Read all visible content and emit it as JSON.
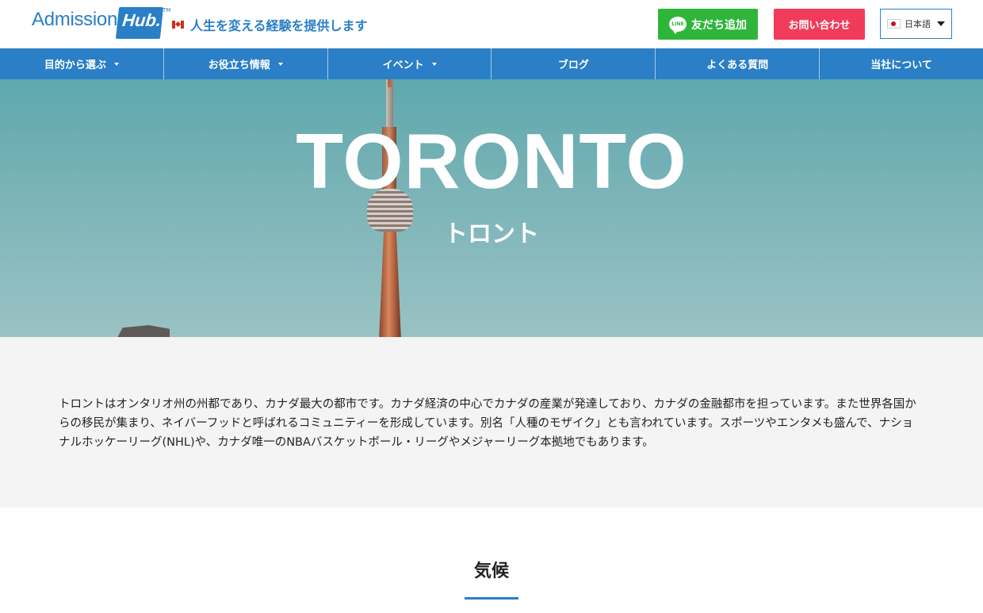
{
  "header": {
    "logo_text": "Admission",
    "logo_badge": "Hub.",
    "logo_tm": "TM",
    "tagline": "人生を変える経験を提供します",
    "line_button": "友だち追加",
    "line_icon_text": "LINE",
    "contact_button": "お問い合わせ",
    "language": "日本語"
  },
  "nav": {
    "items": [
      {
        "label": "目的から選ぶ"
      },
      {
        "label": "お役立ち情報"
      },
      {
        "label": "イベント"
      },
      {
        "label": "ブログ"
      },
      {
        "label": "よくある質問"
      },
      {
        "label": "当社について"
      }
    ]
  },
  "hero": {
    "title": "TORONTO",
    "subtitle": "トロント"
  },
  "intro": {
    "text": "トロントはオンタリオ州の州都であり、カナダ最大の都市です。カナダ経済の中心でカナダの産業が発達しており、カナダの金融都市を担っています。また世界各国からの移民が集まり、ネイバーフッドと呼ばれるコミュニティーを形成しています。別名「人種のモザイク」とも言われています。スポーツやエンタメも盛んで、ナショナルホッケーリーグ(NHL)や、カナダ唯一のNBAバスケットボール・リーグやメジャーリーグ本拠地でもあります。"
  },
  "section": {
    "title": "気候"
  },
  "colors": {
    "brand_blue": "#2a7fc6",
    "line_green": "#2fb53a",
    "contact_red": "#f03c5a"
  },
  "icons": {
    "canada_flag": "canada-flag-icon",
    "japan_flag": "japan-flag-icon",
    "line": "line-icon",
    "dropdown": "chevron-down-icon"
  }
}
